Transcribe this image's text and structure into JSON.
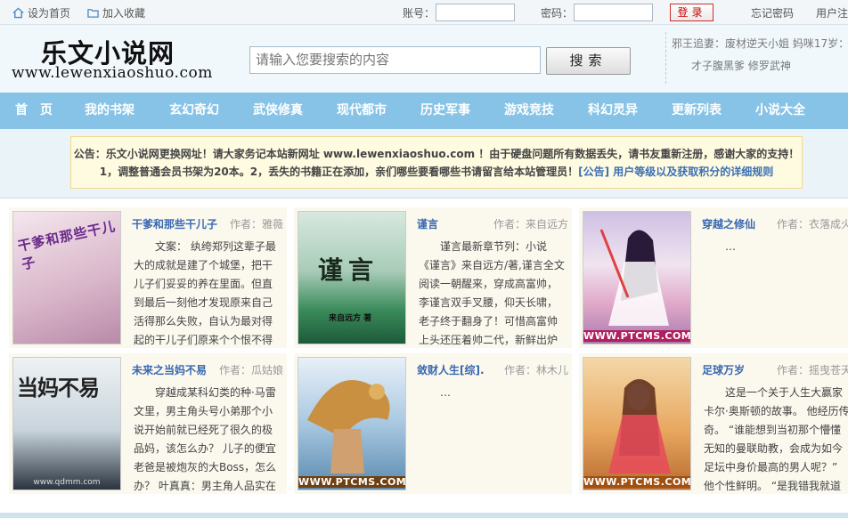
{
  "topbar": {
    "home_link": "设为首页",
    "fav_link": "加入收藏",
    "account_label": "账号：",
    "password_label": "密码：",
    "login_button": "登录",
    "forgot_link": "忘记密码",
    "register_link": "用户注"
  },
  "header": {
    "logo_cn": "乐文小说网",
    "logo_url": "www.lewenxiaoshuo.com",
    "search_placeholder": "请输入您要搜索的内容",
    "search_button": "搜索",
    "hot_line1": "邪王追妻：废材逆天小姐   妈咪17岁：",
    "hot_line2": "   才子腹黑爹   修罗武神"
  },
  "nav": {
    "items": [
      "首　页",
      "我的书架",
      "玄幻奇幻",
      "武侠修真",
      "现代都市",
      "历史军事",
      "游戏竞技",
      "科幻灵异",
      "更新列表",
      "小说大全"
    ]
  },
  "notice": {
    "line1": "公告：乐文小说网更换网址！请大家务记本站新网址 www.lewenxiaoshuo.com ！由于硬盘问题所有数据丢失，请书友重新注册，感谢大家的支持！",
    "line2": "1，调整普通会员书架为20本。2，丢失的书籍正在添加，亲们哪些要看哪些书请留言给本站管理员！",
    "link": "[公告] 用户等级以及获取积分的详细规则"
  },
  "books": [
    {
      "title": "干爹和那些干儿子",
      "author": "作者：雅薇",
      "desc": "文案： 纨绔郑列这辈子最大的成就是建了个城堡，把干儿子们妥妥的养在里面。但直到最后一刻他才发现原来自己活得那么失败，自认为最对得起的干儿子们原来个个恨不得他去死……",
      "cover_text": "干爹和那些干儿子",
      "cover_color": "#e6c8d8"
    },
    {
      "title": "谨言",
      "author": "作者：来自远方",
      "desc": "谨言最新章节列：小说《谨言》来自远方/著,谨言全文阅读一朝醒来，穿成高富帅，李谨言双手叉腰，仰天长啸，老子终于翻身了！可惜高富帅上头还压着帅二代，新鲜出炉的李家三",
      "cover_text": "谨言",
      "cover_sub": "来自远方 著",
      "cover_color": "#2e7a4e"
    },
    {
      "title": "穿越之修仙",
      "author": "作者：衣落成火",
      "desc": "…",
      "cover_text": "WWW.PTCMS.COM",
      "cover_color": "#d8b0c8"
    },
    {
      "title": "未来之当妈不易",
      "author": "作者：瓜姑娘",
      "desc": "穿越成某科幻类的种·马雷文里，男主角头号小弟那个小说开始前就已经死了很久的极品妈，该怎么办？ 儿子的便宜老爸是被炮灰的大Boss，怎么办？ 叶真真：男主角人品实在",
      "cover_text": "当妈不易",
      "cover_sub": "www.qdmm.com",
      "cover_color": "#c8d4dc"
    },
    {
      "title": "敛财人生[综].",
      "author": "作者：林木儿",
      "desc": "…",
      "cover_text": "WWW.PTCMS.COM",
      "cover_color": "#7ca8c8"
    },
    {
      "title": "足球万岁",
      "author": "作者：摇曳苍天",
      "desc": "这是一个关于人生大赢家卡尔·奥斯顿的故事。 他经历传奇。 “谁能想到当初那个懵懂无知的曼联助教，会成为如今足坛中身价最高的男人呢？” 他个性鲜明。 “是我错我就道",
      "cover_text": "WWW.PTCMS.COM",
      "cover_color": "#e8b070"
    }
  ],
  "colors": {
    "nav_bg": "#87c3e6",
    "title_blue": "#3868b0",
    "login_red": "#cc0000"
  }
}
